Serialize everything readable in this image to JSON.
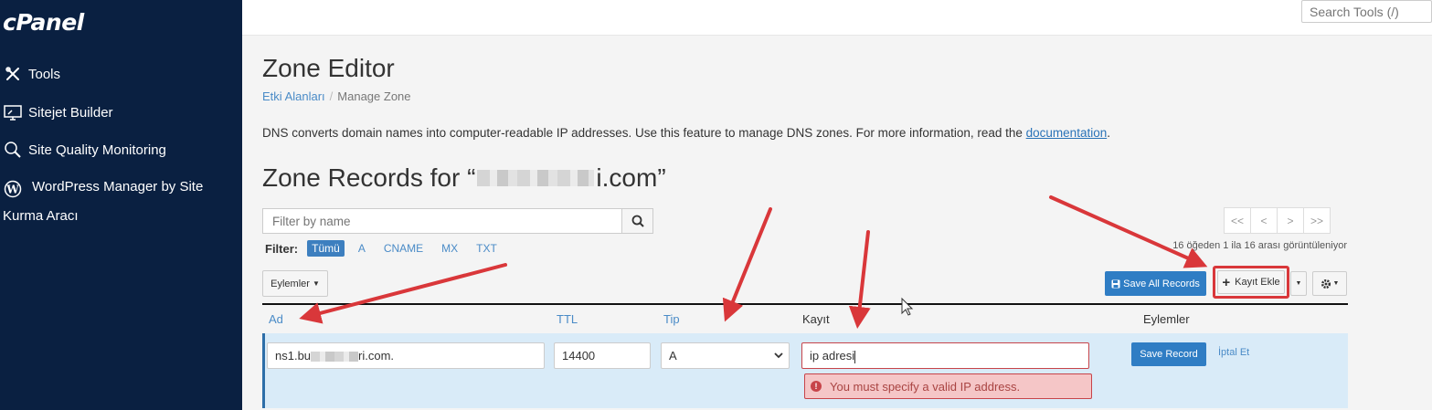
{
  "brand": {
    "logo": "cPanel"
  },
  "sidebar": {
    "items": [
      {
        "label": "Tools",
        "icon": "tools-icon"
      },
      {
        "label": "Sitejet Builder",
        "icon": "monitor-icon"
      },
      {
        "label": "Site Quality Monitoring",
        "icon": "magnifier-icon"
      },
      {
        "label": "WordPress Manager by Site",
        "icon": "wordpress-icon"
      }
    ],
    "wrap_label": "Kurma Aracı"
  },
  "topbar": {
    "search_placeholder": "Search Tools (/)"
  },
  "page": {
    "title": "Zone Editor",
    "breadcrumb": [
      "Etki Alanları",
      "Manage Zone"
    ],
    "description_prefix": "DNS converts domain names into computer-readable IP addresses. Use this feature to manage DNS zones. For more information, read the ",
    "description_link": "documentation",
    "description_suffix": ".",
    "zone_title_prefix": "Zone Records for “",
    "zone_title_suffix": "i.com”"
  },
  "filter": {
    "placeholder": "Filter by name",
    "label": "Filter:",
    "types": [
      "Tümü",
      "A",
      "CNAME",
      "MX",
      "TXT"
    ],
    "active": "Tümü"
  },
  "pager": {
    "buttons": [
      "<<",
      "<",
      ">",
      ">>"
    ],
    "count_text": "16 öğeden 1 ila 16 arası görüntüleniyor"
  },
  "toolbar": {
    "actions_label": "Eylemler",
    "save_all_label": "Save All Records",
    "add_label": "Kayıt Ekle"
  },
  "table": {
    "headers": [
      "Ad",
      "TTL",
      "Tip",
      "Kayıt",
      "Eylemler"
    ]
  },
  "edit_row": {
    "name_prefix": "ns1.bu",
    "name_suffix": "ri.com.",
    "ttl": "14400",
    "type": "A",
    "record": "ip adresi",
    "error": "You must specify a valid IP address.",
    "save_label": "Save Record",
    "cancel_label": "İptal Et"
  },
  "colors": {
    "sidebar": "#0a2041",
    "primary": "#2f7dc4",
    "annotation": "#d9373a",
    "error_bg": "#f5c6c7"
  }
}
